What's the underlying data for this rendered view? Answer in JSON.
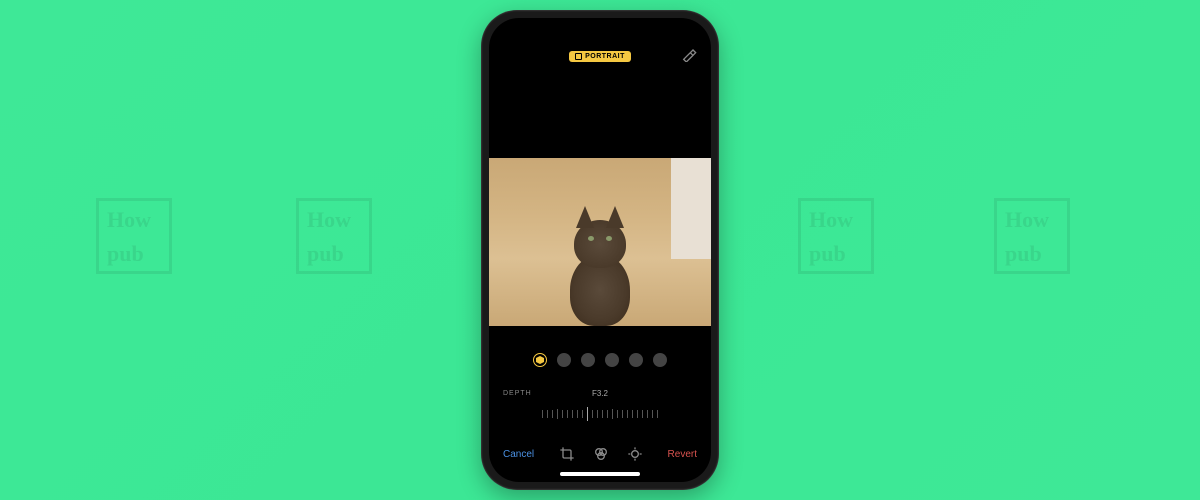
{
  "watermark": {
    "top_text": "How",
    "bottom_text": "pub"
  },
  "editor": {
    "mode_badge": "PORTRAIT",
    "depth": {
      "label": "DEPTH",
      "value": "F3.2"
    },
    "lighting_modes": [
      "natural",
      "studio",
      "contour",
      "stage",
      "stage-mono",
      "high-key"
    ],
    "active_lighting": 0,
    "bottom_bar": {
      "cancel": "Cancel",
      "revert": "Revert"
    },
    "tools": [
      "crop",
      "filters",
      "adjust"
    ]
  }
}
